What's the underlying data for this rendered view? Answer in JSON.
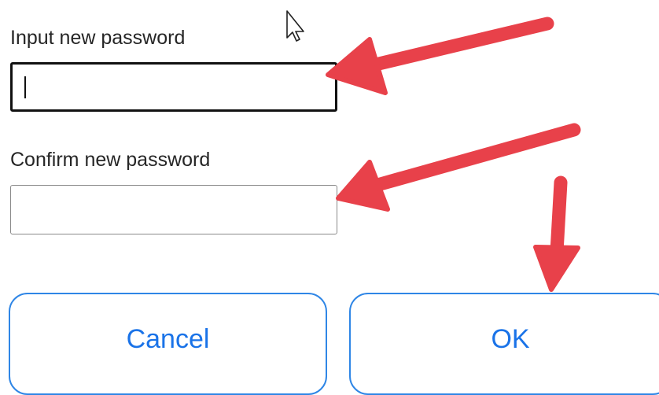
{
  "form": {
    "new_password_label": "Input new password",
    "new_password_value": "",
    "confirm_password_label": "Confirm new password",
    "confirm_password_value": ""
  },
  "buttons": {
    "cancel_label": "Cancel",
    "ok_label": "OK"
  },
  "annotations": {
    "arrow_color": "#e8414a",
    "cursor_icon": "mouse-pointer-icon"
  },
  "colors": {
    "button_border": "#2f86e6",
    "button_text": "#1a73e8",
    "focused_border": "#111111"
  }
}
